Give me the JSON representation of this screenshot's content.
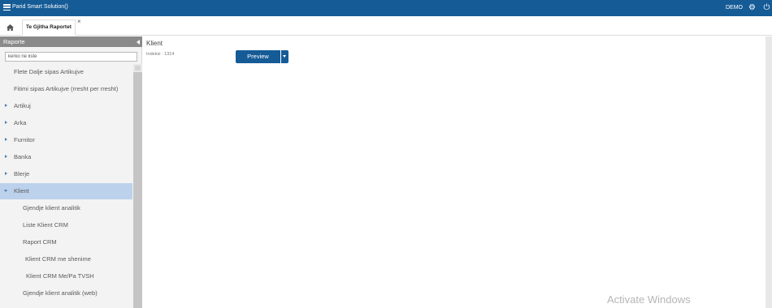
{
  "header": {
    "app_title": "Parid Smart Solution()",
    "user": "DEMO",
    "icons": [
      "menu-icon",
      "settings-icon",
      "power-icon"
    ]
  },
  "tabs": {
    "home_icon": "home-icon",
    "items": [
      {
        "label": "Te Gjitha Raportet",
        "close": "×"
      }
    ]
  },
  "sidebar": {
    "title": "Raporte",
    "search_placeholder": "kerko ne liste",
    "items": [
      {
        "label": "Flete Dalje sipas Artikujve",
        "type": "leaf"
      },
      {
        "label": "Fitimi sipas Artikujve (rresht per rresht)",
        "type": "leaf"
      },
      {
        "label": "Artikuj",
        "type": "folder"
      },
      {
        "label": "Arka",
        "type": "folder"
      },
      {
        "label": "Furnitor",
        "type": "folder"
      },
      {
        "label": "Banka",
        "type": "folder"
      },
      {
        "label": "Blerje",
        "type": "folder"
      },
      {
        "label": "Klient",
        "type": "folder-open",
        "selected": true
      },
      {
        "label": "Gjendje klient analitik",
        "type": "child"
      },
      {
        "label": "Liste Klient CRM",
        "type": "child"
      },
      {
        "label": "Raport CRM",
        "type": "child"
      },
      {
        "label": "Klient CRM me shenime",
        "type": "child"
      },
      {
        "label": "Klient CRM Me/Pa TVSH",
        "type": "child"
      },
      {
        "label": "Gjendje klient analitik (web)",
        "type": "child"
      }
    ]
  },
  "content": {
    "title": "Klient",
    "index_label": "Indeksi :",
    "index_value": "1314",
    "preview_label": "Preview"
  },
  "watermark": "Activate Windows",
  "colors": {
    "accent": "#155b96",
    "selected": "#bcd1ec"
  }
}
